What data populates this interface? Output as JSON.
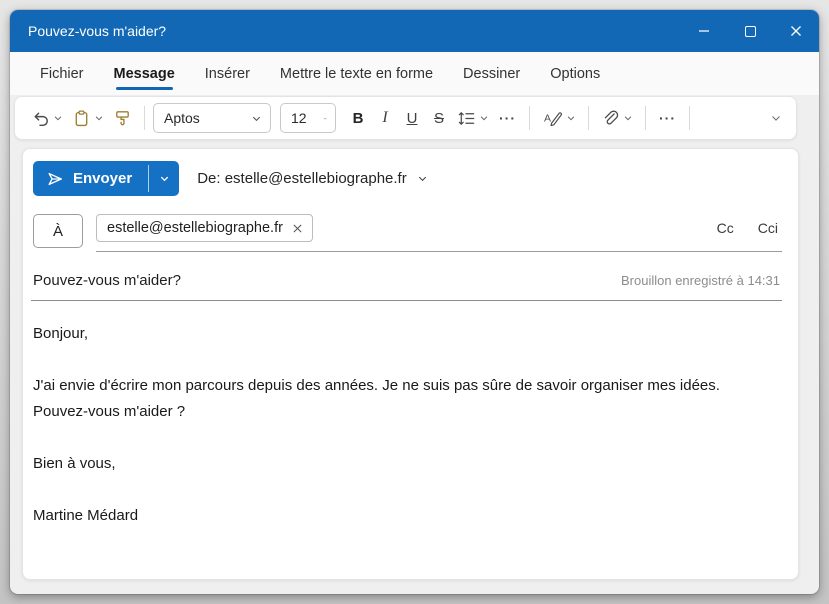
{
  "window": {
    "title": "Pouvez-vous m'aider?"
  },
  "ribbon": {
    "tabs": [
      {
        "label": "Fichier"
      },
      {
        "label": "Message"
      },
      {
        "label": "Insérer"
      },
      {
        "label": "Mettre le texte en forme"
      },
      {
        "label": "Dessiner"
      },
      {
        "label": "Options"
      }
    ]
  },
  "toolbar": {
    "font_name": "Aptos",
    "font_size": "12",
    "bold_label": "B",
    "italic_label": "I",
    "underline_label": "U",
    "strikethrough_label": "S",
    "more_label": "···"
  },
  "compose": {
    "send_label": "Envoyer",
    "from_value": "De: estelle@estellebiographe.fr",
    "to_label": "À",
    "recipient_chip": "estelle@estellebiographe.fr",
    "cc_label": "Cc",
    "cci_label": "Cci",
    "subject": "Pouvez-vous m'aider?",
    "draft_status": "Brouillon enregistré à 14:31"
  },
  "body": {
    "p1": "Bonjour,",
    "p2": "J'ai envie d'écrire mon parcours depuis des années. Je ne suis pas sûre de savoir organiser mes idées. Pouvez-vous m'aider ?",
    "p3": "Bien à vous,",
    "p4": "Martine Médard"
  },
  "colors": {
    "titlebar_blue": "#1268b4",
    "send_button_blue": "#1471c4",
    "tab_underline_blue": "#1267b4",
    "gold_icon": "#9d7d2e"
  }
}
